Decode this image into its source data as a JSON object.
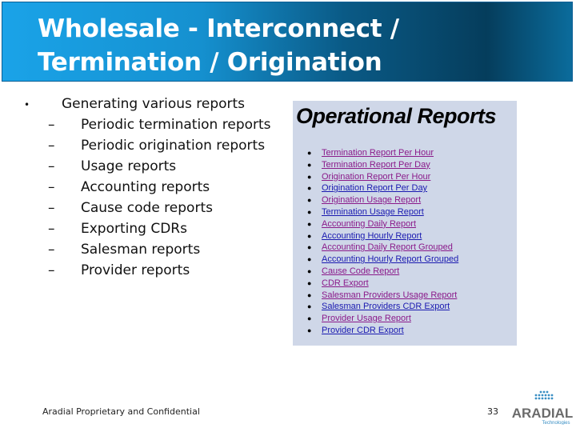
{
  "header": {
    "title_line1": "Wholesale - Interconnect /",
    "title_line2": "Termination / Origination"
  },
  "bullets": {
    "main": "Generating various reports",
    "sub": [
      "Periodic termination reports",
      "Periodic origination reports",
      "Usage reports",
      "Accounting reports",
      "Cause code reports",
      "Exporting CDRs",
      "Salesman reports",
      "Provider reports"
    ]
  },
  "screenshot": {
    "title": "Operational Reports",
    "links": [
      {
        "label": "Termination Report Per Hour",
        "visited": true
      },
      {
        "label": "Termination Report Per Day",
        "visited": true
      },
      {
        "label": "Origination Report Per Hour",
        "visited": true
      },
      {
        "label": "Origination Report Per Day",
        "visited": false
      },
      {
        "label": "Origination Usage Report",
        "visited": true
      },
      {
        "label": "Termination Usage Report",
        "visited": false
      },
      {
        "label": "Accounting Daily Report",
        "visited": true
      },
      {
        "label": "Accounting Hourly Report",
        "visited": false
      },
      {
        "label": "Accounting Daily Report Grouped",
        "visited": true
      },
      {
        "label": "Accounting Hourly Report Grouped",
        "visited": false
      },
      {
        "label": "Cause Code Report",
        "visited": true
      },
      {
        "label": "CDR Export",
        "visited": true
      },
      {
        "label": "Salesman Providers Usage Report",
        "visited": true
      },
      {
        "label": "Salesman Providers CDR Export",
        "visited": false
      },
      {
        "label": "Provider Usage Report",
        "visited": true
      },
      {
        "label": "Provider CDR Export",
        "visited": false
      }
    ],
    "colors": {
      "visited": "#8a1a8a",
      "link": "#1a1ab0"
    }
  },
  "footer": {
    "text": "Aradial Proprietary and Confidential",
    "page": "33",
    "logo_text": "ARADIAL",
    "logo_sub": "Technologies"
  }
}
